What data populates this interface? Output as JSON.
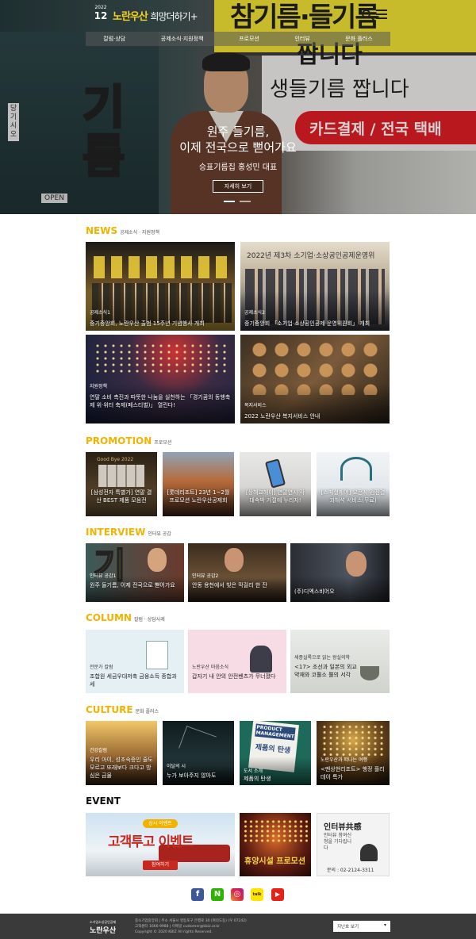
{
  "header": {
    "issue_year": "2022",
    "issue_month": "12",
    "brand": "노란우산",
    "tagline": "희망더하기+",
    "nav": [
      "칼럼·상담",
      "공제소식·지원정책",
      "프로모션",
      "인터뷰",
      "문화 플러스"
    ]
  },
  "hero": {
    "sign_top": "참기름·들기름",
    "sign_mid": "짭니다",
    "sign_line": "생들기름 짭니다",
    "sign_red": "카드결제 / 전국 택배",
    "door_text": "당기시오",
    "open_text": "OPEN",
    "big_chars": [
      "기",
      "름"
    ],
    "headline_1": "원주 들기름,",
    "headline_2": "이제 전국으로 뻗어가요",
    "subtitle": "승표기름집 홍성민 대표",
    "button": "자세히 보기"
  },
  "news": {
    "title": "NEWS",
    "sub": "공제소식 · 지원정책",
    "items": [
      {
        "cat": "공제소식1",
        "text": "중기중앙회, 노란우산 출범 15주년 기념행사 개최",
        "color": "#4a3a25"
      },
      {
        "cat": "공제소식2",
        "text": "중기중앙회 「소기업·소상공인공제 운영위원회」 개최",
        "color": "#6b5a48",
        "banner": "2022년 제3차 소기업·소상공인공제운영위"
      },
      {
        "cat": "지원정책",
        "text": "연말 소비 촉진과 따뜻한 나눔을 실천하는 「경기꿈의 동행축제 위·위터 축제(페스티벌)」 열린다!",
        "color": "#2a3a55"
      },
      {
        "cat": "복지서비스",
        "text": "2022 노란우산 복지서비스 안내",
        "color": "#6a4a30"
      }
    ]
  },
  "promotion": {
    "title": "PROMOTION",
    "sub": "프로모션",
    "items": [
      {
        "text": "[삼성전자 특별가] 연말 결산 BEST 제품 모음전",
        "badge": "Good Bye 2022"
      },
      {
        "text": "[롯데리조트] 23년 1~2월 프로모션 노란우산공제회"
      },
      {
        "text": "[상해교해이] 연말연시 각 대속박 거절에 누리자!"
      },
      {
        "text": "[스페셜케어] 오픈시 검진결과해석 서비스(무료)"
      }
    ]
  },
  "interview": {
    "title": "INTERVIEW",
    "sub": "인터뷰 공감",
    "items": [
      {
        "cat": "인터뷰 공감1",
        "text": "원주 들기름, 이제 전국으로 뻗어가요"
      },
      {
        "cat": "인터뷰 공감2",
        "text": "안동 용천에서 빚은 막걸리 한 잔"
      },
      {
        "cat": "",
        "text": "(주)디엑스비어오"
      }
    ]
  },
  "column": {
    "title": "COLUMN",
    "sub": "칼럼 · 상담사례",
    "items": [
      {
        "cat": "전문가 칼럼",
        "text": "조합원 세금우대저축 금융소득 종합과세"
      },
      {
        "cat": "노란우산 마음소식",
        "text": "갑자기 내 안의 안전벤츠가 무너졌다"
      },
      {
        "cat": "세종실록으로 읽는 왕실의학",
        "text": "<17> 조선과 일본의 외교 약재와 코뿔소 뿔의 서각"
      }
    ]
  },
  "culture": {
    "title": "CULTURE",
    "sub": "문화 플러스",
    "items": [
      {
        "cat": "건강칼럼",
        "text": "우리 아이, 성조숙증인 줄도 모르고 또래보다 크다고 방심은 금물"
      },
      {
        "cat": "이달의 시",
        "text": "누가 보아주지 않아도"
      },
      {
        "cat": "도서 소개",
        "text": "제품의 탄생",
        "book_title": "PRODUCT MANAGEMENT",
        "book_kr": "제품의 탄생"
      },
      {
        "cat": "노란우산과 떠나는 여행",
        "text": "<맨상현리조트> 행정 플리데이 특가"
      }
    ]
  },
  "event": {
    "title": "EVENT",
    "items": [
      {
        "badge": "상시 이벤트",
        "title": "고객투고 이벤트",
        "button": "참여하기"
      },
      {
        "title": "휴양시설 프로모션"
      },
      {
        "title": "인터뷰共感",
        "sub": "인터뷰 참여신청을 기다립니다",
        "phone": "문의 : 02-2124-3311"
      }
    ]
  },
  "social": [
    "f",
    "N",
    "◎",
    "talk",
    "▶"
  ],
  "footer": {
    "logo_top": "소기업소상공인공제",
    "logo": "노란우산",
    "info_1": "중소기업중앙회 | 주소 서울시 영등포구 은행로 30 (여의도동) (우 07242)",
    "info_2": "고객센터 1666-9988 | 이메일 customer@kbiz.or.kr",
    "info_3": "Copyright © 2020 KBIZ All rights Reserved.",
    "select": "지난호 보기"
  }
}
